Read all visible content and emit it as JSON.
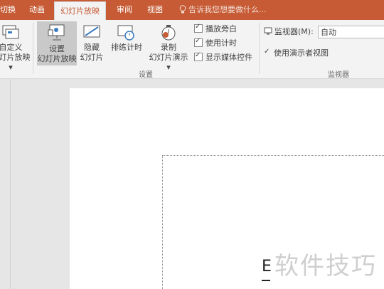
{
  "tabs": [
    {
      "label": "切换"
    },
    {
      "label": "动画"
    },
    {
      "label": "幻灯片放映",
      "active": true
    },
    {
      "label": "审阅"
    },
    {
      "label": "视图"
    }
  ],
  "tell_me": "告诉我您想要做什么...",
  "ribbon": {
    "custom_show": {
      "line1": "自定义",
      "line2": "幻灯片放映 ▾"
    },
    "setup_show": {
      "line1": "设置",
      "line2": "幻灯片放映"
    },
    "hide_slide": {
      "line1": "隐藏",
      "line2": "幻灯片"
    },
    "rehearse": {
      "line1": "排练计时"
    },
    "record": {
      "line1": "录制",
      "line2": "幻灯片演示 ▾"
    },
    "checks": {
      "play_narration": "播放旁白",
      "use_timings": "使用计时",
      "show_media_controls": "显示媒体控件"
    },
    "group_setup": "设置",
    "monitor_label": "监视器(M):",
    "monitor_value": "自动",
    "presenter_view": "使用演示者视图",
    "group_monitors": "监视器"
  },
  "slide": {
    "typed_char": "E"
  },
  "watermark": "软件技巧",
  "colors": {
    "accent": "#c65b35",
    "ribbon_bg": "#f3f3f3",
    "workspace_bg": "#e6e6e6"
  }
}
